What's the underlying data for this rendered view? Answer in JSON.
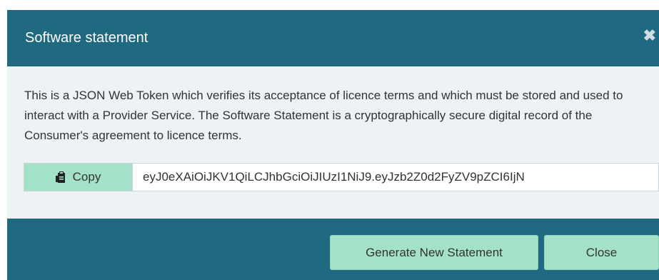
{
  "modal": {
    "title": "Software statement",
    "close_icon": "close-icon",
    "description": "This is a JSON Web Token which verifies its acceptance of licence terms and which must be stored and used to interact with a Provider Service. The Software Statement is a cryptographically secure digital record of the Consumer's agreement to licence terms.",
    "copy": {
      "icon": "clipboard-icon",
      "label": "Copy"
    },
    "token_value": "eyJ0eXAiOiJKV1QiLCJhbGciOiJIUzI1NiJ9.eyJzb2Z0d2FyZV9pZCI6IjN",
    "footer": {
      "generate_label": "Generate New Statement",
      "close_label": "Close"
    }
  },
  "colors": {
    "header_bg": "#1f6a81",
    "body_bg": "#edf2f4",
    "button_bg": "#a3e2c8"
  }
}
